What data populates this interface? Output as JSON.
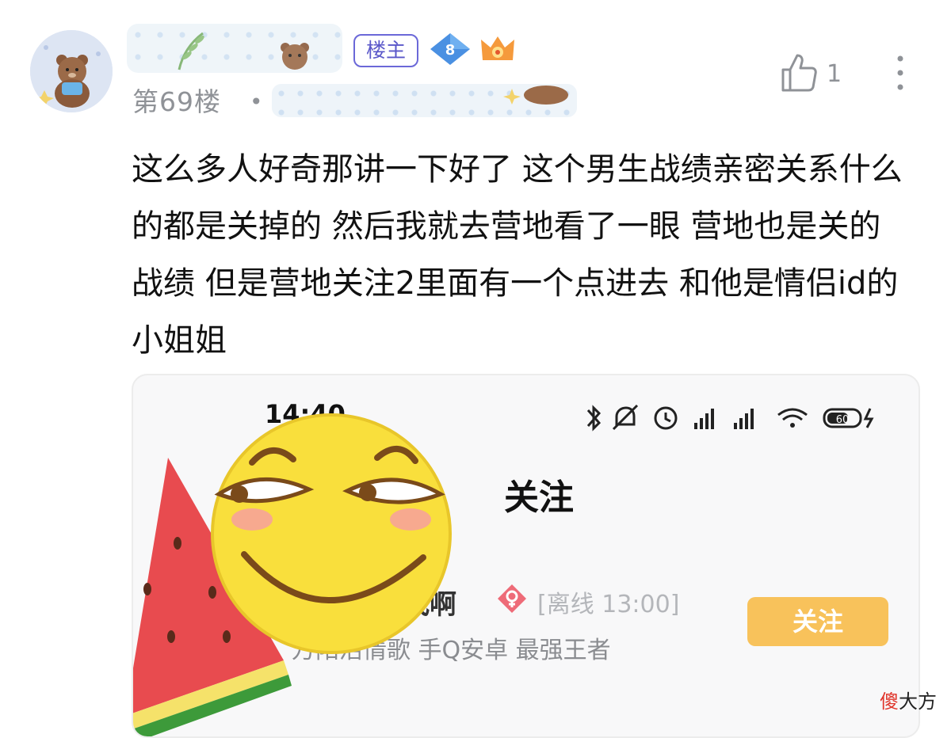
{
  "post": {
    "owner_badge": "楼主",
    "level": "8",
    "floor": "第69楼",
    "separator": "•",
    "likes": "1",
    "content": "这么多人好奇那讲一下好了 这个男生战绩亲密关系什么的都是关掉的 然后我就去营地看了一眼 营地也是关的战绩 但是营地关注2里面有一个点进去 和他是情侣id的小姐姐"
  },
  "screenshot": {
    "time": "14:40",
    "battery": "60",
    "title": "关注",
    "user_name_partial": "找啊",
    "offline_status": "[离线 13:00]",
    "description": "万阳活情歌 手Q安卓 最强王者",
    "follow_button": "关注"
  },
  "watermark": {
    "first": "傻",
    "rest": "大方"
  },
  "colors": {
    "owner_badge": "#5a57c9",
    "level_badge": "#4a90e2",
    "follow_button": "#f8c25b",
    "meta_gray": "#8f9297"
  }
}
